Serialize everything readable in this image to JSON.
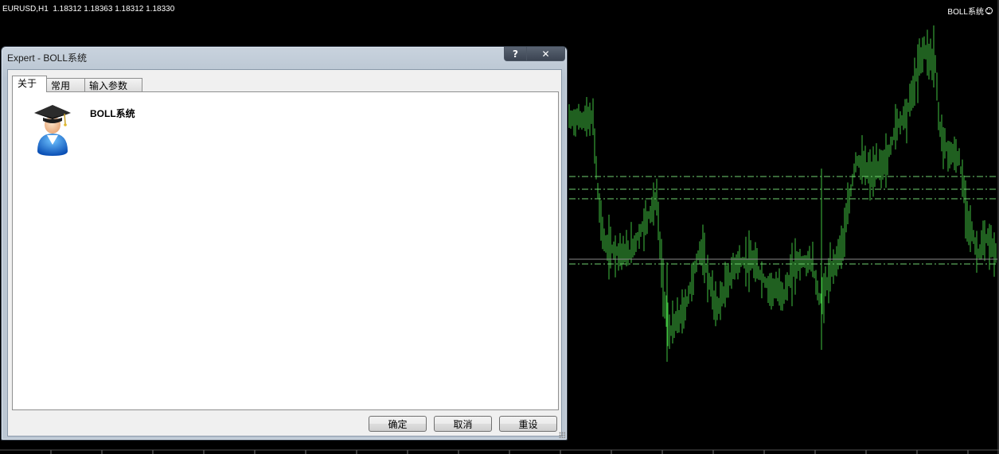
{
  "chart": {
    "symbol_header": "EURUSD,H1  1.18312 1.18363 1.18312 1.18330",
    "ea_label": "BOLL系统",
    "candle_color": "#3fbf3f",
    "band_color": "#6fcf6f"
  },
  "dialog": {
    "title": "Expert - BOLL系统",
    "help_label": "?",
    "close_label": "✕",
    "tabs": [
      {
        "label": "关于",
        "active": true
      },
      {
        "label": "常用",
        "active": false
      },
      {
        "label": "输入参数",
        "active": false
      }
    ],
    "about": {
      "icon": "graduate-user-icon",
      "ea_name": "BOLL系统"
    },
    "buttons": {
      "ok": "确定",
      "cancel": "取消",
      "reset": "重设"
    }
  }
}
